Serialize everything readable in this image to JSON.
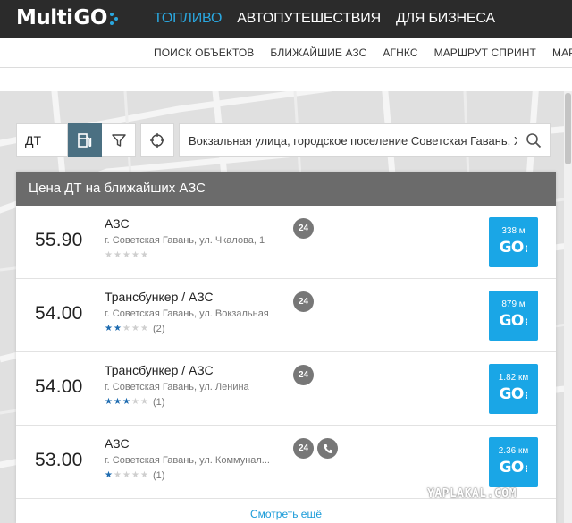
{
  "brand": {
    "logo_text": "Multi",
    "logo_go": "GO",
    "accent": "#2aa8e0"
  },
  "topnav": [
    {
      "label": "ТОПЛИВО",
      "active": true
    },
    {
      "label": "АВТОПУТЕШЕСТВИЯ",
      "active": false
    },
    {
      "label": "ДЛЯ БИЗНЕСА",
      "active": false
    }
  ],
  "subnav": [
    "ПОИСК ОБЪЕКТОВ",
    "БЛИЖАЙШИЕ АЗС",
    "АГНКС",
    "МАРШРУТ СПРИНТ",
    "МАРШ"
  ],
  "search": {
    "fuel": "ДТ",
    "address": "Вокзальная улица, городское поселение Советская Гавань, Хабаровский край"
  },
  "panel": {
    "title": "Цена ДТ на ближайших АЗС",
    "more": "Смотреть ещё",
    "stations": [
      {
        "price": "55.90",
        "name": "АЗС",
        "address": "г. Советская Гавань, ул. Чкалова, 1",
        "stars": 0,
        "reviews": "",
        "open24": "24",
        "phone": false,
        "distance": "338 м"
      },
      {
        "price": "54.00",
        "name": "Трансбункер / АЗС",
        "address": "г. Советская Гавань, ул. Вокзальная",
        "stars": 2,
        "reviews": "(2)",
        "open24": "24",
        "phone": false,
        "distance": "879 м"
      },
      {
        "price": "54.00",
        "name": "Трансбункер / АЗС",
        "address": "г. Советская Гавань, ул. Ленина",
        "stars": 2.5,
        "reviews": "(1)",
        "open24": "24",
        "phone": false,
        "distance": "1.82 км"
      },
      {
        "price": "53.00",
        "name": "АЗС",
        "address": "г. Советская Гавань, ул. Коммунал...",
        "stars": 1,
        "reviews": "(1)",
        "open24": "24",
        "phone": true,
        "distance": "2.36 км"
      }
    ]
  },
  "go_button": {
    "label": "GO",
    "color": "#1aa6e6"
  },
  "icons": {
    "fuel_station": "fuel-pump-icon",
    "filter": "filter-icon",
    "locate": "crosshair-icon",
    "search": "magnifier-icon",
    "phone": "phone-icon"
  },
  "watermark": "YAPLAKAL.COM"
}
